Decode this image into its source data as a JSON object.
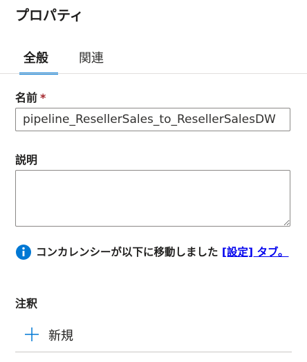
{
  "panel": {
    "title": "プロパティ"
  },
  "tabs": [
    {
      "label": "全般",
      "active": true
    },
    {
      "label": "関連",
      "active": false
    }
  ],
  "name_field": {
    "label": "名前",
    "required_mark": "*",
    "value": "pipeline_ResellerSales_to_ResellerSalesDW"
  },
  "description_field": {
    "label": "説明",
    "value": ""
  },
  "info": {
    "icon": "info-icon",
    "text": "コンカレンシーが以下に移動しました ",
    "link_text": "[設定] タブ。",
    "color": "#0078d4"
  },
  "annotations": {
    "label": "注釈",
    "add_label": "新規",
    "add_icon": "plus-icon"
  },
  "colors": {
    "accent": "#0078d4",
    "link": "#0000ee",
    "required": "#a4262c"
  }
}
